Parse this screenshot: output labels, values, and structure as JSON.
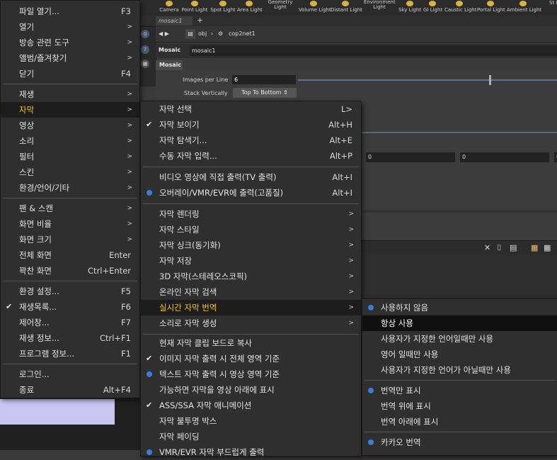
{
  "background_app": {
    "shelf_buttons": [
      "Camera",
      "Point Light",
      "Spot Light",
      "Area Light",
      "Geometry Light",
      "Volume Light",
      "Distant Light",
      "Environment Light",
      "Sky Light",
      "GI Light",
      "Caustic Light",
      "Portal Light",
      "Ambient Light",
      "St Ca"
    ],
    "tab_label": "mosaic1",
    "tab_plus": "+",
    "path": {
      "root": "obj",
      "node": "cop2net1"
    },
    "node_type": "Mosaic",
    "node_name": "mosaic1",
    "operator_tab": "Mosaic",
    "parms": {
      "images_per_line_label": "Images per Line",
      "images_per_line_value": "6",
      "stack_vertically_label": "Stack Vertically",
      "stack_vertically_value": "Top To Bottom"
    },
    "value_fields": [
      "0",
      "0",
      "0"
    ],
    "accent_color": "#f2c316",
    "radio_color": "#3b7bd9"
  },
  "main_menu": {
    "items": [
      {
        "label": "파일 열기...",
        "shortcut": "F3"
      },
      {
        "label": "열기",
        "arrow": ">"
      },
      {
        "label": "방송 관련 도구",
        "arrow": ">"
      },
      {
        "label": "앨범/즐겨찾기",
        "arrow": ">"
      },
      {
        "label": "닫기",
        "shortcut": "F4"
      },
      {
        "label": "재생",
        "arrow": ">"
      },
      {
        "label": "자막",
        "arrow": ">"
      },
      {
        "label": "영상",
        "arrow": ">"
      },
      {
        "label": "소리",
        "arrow": ">"
      },
      {
        "label": "필터",
        "arrow": ">"
      },
      {
        "label": "스킨",
        "arrow": ">"
      },
      {
        "label": "환경/언어/기타",
        "arrow": ">"
      },
      {
        "label": "팬 & 스캔",
        "arrow": ">"
      },
      {
        "label": "화면 비율",
        "arrow": ">"
      },
      {
        "label": "화면 크기",
        "arrow": ">"
      },
      {
        "label": "전체 화면",
        "shortcut": "Enter"
      },
      {
        "label": "꽉찬 화면",
        "shortcut": "Ctrl+Enter"
      },
      {
        "label": "환경 설정...",
        "shortcut": "F5"
      },
      {
        "label": "재생목록...",
        "shortcut": "F6"
      },
      {
        "label": "제어창...",
        "shortcut": "F7"
      },
      {
        "label": "재생 정보...",
        "shortcut": "Ctrl+F1"
      },
      {
        "label": "프로그램 정보...",
        "shortcut": "F1"
      },
      {
        "label": "로그인..."
      },
      {
        "label": "종료",
        "shortcut": "Alt+F4"
      }
    ]
  },
  "subtitle_menu": {
    "items": [
      {
        "label": "자막 선택",
        "shortcut": "L>"
      },
      {
        "label": "자막 보이기",
        "shortcut": "Alt+H"
      },
      {
        "label": "자막 탐색기...",
        "shortcut": "Alt+E"
      },
      {
        "label": "수동 자막 입력...",
        "shortcut": "Alt+P"
      },
      {
        "label": "비디오 영상에 직접 출력(TV 출력)",
        "shortcut": "Alt+I"
      },
      {
        "label": "오버레이/VMR/EVR에 출력(고품질)",
        "shortcut": "Alt+I"
      },
      {
        "label": "자막 렌더링",
        "arrow": ">"
      },
      {
        "label": "자막 스타일",
        "arrow": ">"
      },
      {
        "label": "자막 싱크(동기화)",
        "arrow": ">"
      },
      {
        "label": "자막 저장",
        "arrow": ">"
      },
      {
        "label": "3D 자막(스테레오스코픽)",
        "arrow": ">"
      },
      {
        "label": "온라인 자막 검색",
        "arrow": ">"
      },
      {
        "label": "실시간 자막 번역",
        "arrow": ">"
      },
      {
        "label": "소리로 자막 생성",
        "arrow": ">"
      },
      {
        "label": "현재 자막 클립 보드로 복사"
      },
      {
        "label": "이미지 자막 출력 시 전체 영역 기준"
      },
      {
        "label": "텍스트 자막 출력 시 영상 영역 기준"
      },
      {
        "label": "가능하면 자막을 영상 아래에 표시"
      },
      {
        "label": "ASS/SSA 자막 애니메이션"
      },
      {
        "label": "자막 불투명 박스"
      },
      {
        "label": "자막 페이딩"
      },
      {
        "label": "VMR/EVR 자막 부드럽게 출력"
      }
    ]
  },
  "translate_menu": {
    "items": [
      {
        "label": "사용하지 않음"
      },
      {
        "label": "항상 사용"
      },
      {
        "label": "사용자가 지정한 언어일때만 사용"
      },
      {
        "label": "영어 일때만 사용"
      },
      {
        "label": "사용자가 지정한 언어가 아닐때만 사용"
      },
      {
        "label": "번역만 표시"
      },
      {
        "label": "번역 위에 표시"
      },
      {
        "label": "번역 아래에 표시"
      },
      {
        "label": "카카오 번역"
      }
    ]
  }
}
